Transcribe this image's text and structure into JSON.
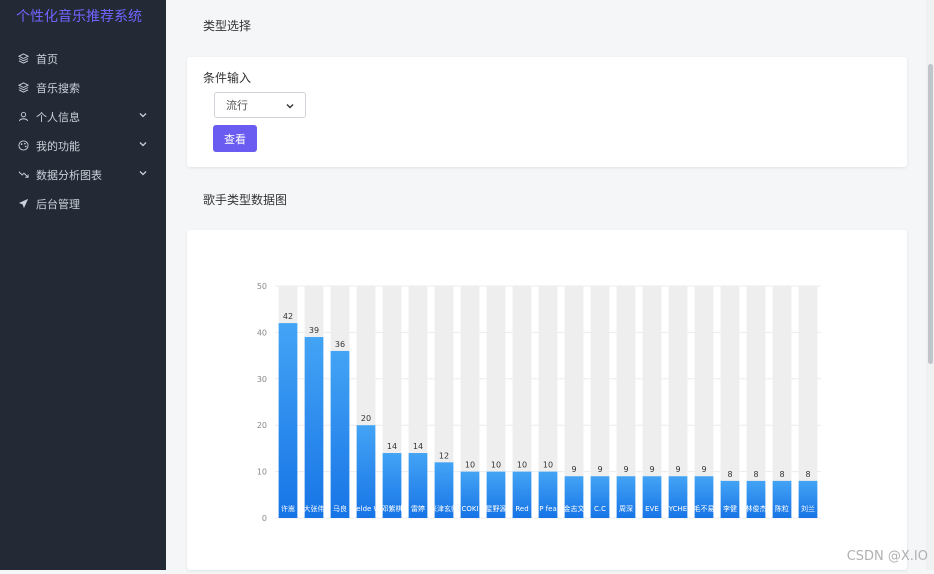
{
  "app": {
    "title": "个性化音乐推荐系统"
  },
  "sidebar": {
    "items": [
      {
        "label": "首页",
        "icon": "layers-icon",
        "expandable": false
      },
      {
        "label": "音乐搜索",
        "icon": "layers-icon",
        "expandable": false
      },
      {
        "label": "个人信息",
        "icon": "user-icon",
        "expandable": true
      },
      {
        "label": "我的功能",
        "icon": "palette-icon",
        "expandable": true
      },
      {
        "label": "数据分析图表",
        "icon": "trend-icon",
        "expandable": true
      },
      {
        "label": "后台管理",
        "icon": "send-icon",
        "expandable": false
      }
    ]
  },
  "main": {
    "type_section_title": "类型选择",
    "condition_label": "条件输入",
    "select_value": "流行",
    "query_button": "查看",
    "chart_section_title": "歌手类型数据图"
  },
  "watermark": "CSDN @X.IO",
  "colors": {
    "sidebar_bg": "#232a35",
    "accent": "#6a5cf0",
    "bar_top": "#43a4f5",
    "bar_bottom": "#1774e6"
  },
  "chart_data": {
    "type": "bar",
    "categories": [
      "许嵩",
      "大张伟",
      "马良",
      "Zelde W",
      "邓紫棋",
      "雷婷",
      "米津玄师",
      "COKI",
      "星野源",
      "Red",
      "P fea",
      "金志文",
      "C.C",
      "周深",
      "EVE",
      "YCHE",
      "毛不易",
      "李健",
      "林俊杰",
      "陈粒",
      "刘兰"
    ],
    "values": [
      42,
      39,
      36,
      20,
      14,
      14,
      12,
      10,
      10,
      10,
      10,
      9,
      9,
      9,
      9,
      9,
      9,
      8,
      8,
      8,
      8
    ],
    "ylim": [
      0,
      50
    ],
    "yticks": [
      0,
      10,
      20,
      30,
      40,
      50
    ],
    "title": "",
    "xlabel": "",
    "ylabel": "",
    "background_bars": true,
    "grid": true
  }
}
